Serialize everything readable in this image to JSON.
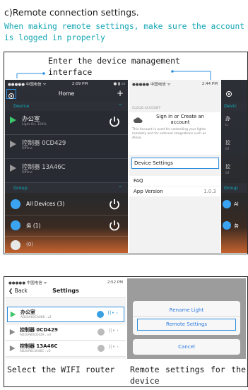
{
  "heading": "c)Remote connection settings.",
  "intro": "When making remote settings, make sure the account is logged in properly",
  "figure1": {
    "callout": "Enter the device management\ninterface",
    "phone_left": {
      "carrier": "●●●●● 中国电信 ᯤ",
      "time": "2:09 PM",
      "battery": "● ▮ ▭",
      "title": "Home",
      "device_section": "Device",
      "devices": [
        {
          "name": "办公室",
          "status": "Light On, 100%"
        },
        {
          "name": "控制器 0CD429",
          "status": "Offline"
        },
        {
          "name": "控制器 13A46C",
          "status": "Offline"
        }
      ],
      "group_section": "Group",
      "groups": [
        {
          "name": "All Devices (3)"
        },
        {
          "name": "务 (1)"
        },
        {
          "name": "(0)"
        }
      ]
    },
    "phone_right": {
      "carrier": "●●●●● 中国电信 ᯤ",
      "time": "2:44 PM",
      "cloud_header": "CLOUD ACCOUNT",
      "sign_in": "Sign in or Create an account",
      "cloud_desc": "This Account is used for controlling your lights remotely and for external integrations such as Alexa.",
      "device_settings": "Device Settings",
      "faq": "FAQ",
      "app_version_label": "App Version",
      "app_version": "1.0.3"
    },
    "peek": {
      "device": "Devic",
      "group": "Group",
      "rows": [
        "办",
        "Li",
        "控",
        "Of",
        "控",
        "Of",
        "Al",
        "务"
      ]
    }
  },
  "figure2": {
    "phone_left": {
      "carrier": "●●●●● 中国电信 ᯤ",
      "time": "2:52 PM",
      "back": "Back",
      "title": "Settings",
      "devices": [
        {
          "name": "办公室",
          "id": "AD20A60CA068 , v3"
        },
        {
          "name": "控制器 0CD429",
          "id": "AD20A60CD429 , v3"
        },
        {
          "name": "控制器 13A46C",
          "id": "AD20A613A46C , v3"
        }
      ]
    },
    "phone_right": {
      "rename": "Rename Light",
      "remote": "Remote Settings",
      "cancel": "Cancel"
    },
    "caption_left": "Select the WIFI router",
    "caption_right": "Remote settings for the device"
  }
}
